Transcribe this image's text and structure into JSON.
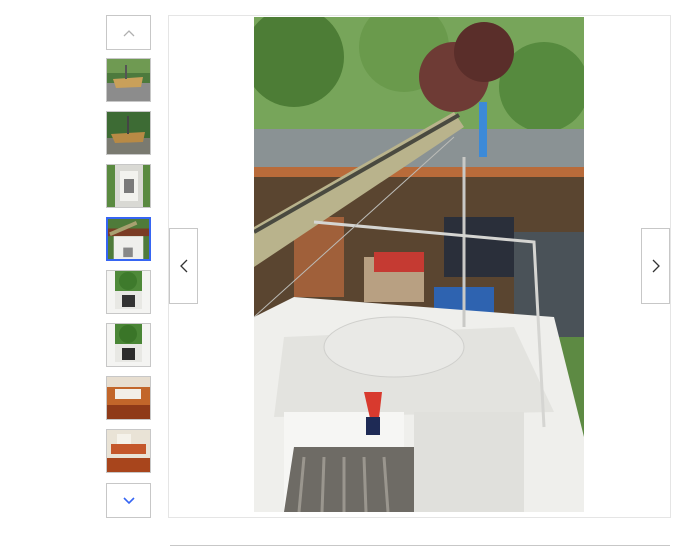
{
  "gallery": {
    "thumbnails": [
      {
        "name": "boat-on-trailer-yard"
      },
      {
        "name": "boat-side-trees"
      },
      {
        "name": "boat-cockpit-top"
      },
      {
        "name": "boat-mast-cockpit"
      },
      {
        "name": "boat-bow-trees"
      },
      {
        "name": "boat-bow-trees-2"
      },
      {
        "name": "boat-cabin-interior"
      },
      {
        "name": "boat-cabin-interior-2"
      }
    ],
    "selected_index": 4,
    "total": 8
  },
  "icons": {
    "scroll_up": "chevron-up-icon",
    "scroll_down": "chevron-down-icon",
    "prev": "chevron-left-icon",
    "next": "chevron-right-icon"
  },
  "colors": {
    "accent": "#3665f3",
    "border": "#c7c7c7"
  }
}
